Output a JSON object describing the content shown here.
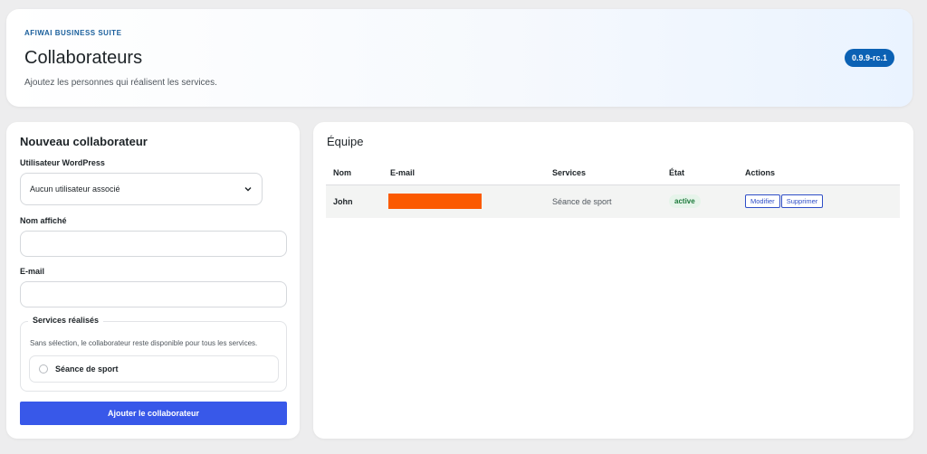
{
  "header": {
    "brand": "AFIWAI BUSINESS SUITE",
    "title": "Collaborateurs",
    "subtitle": "Ajoutez les personnes qui réalisent les services.",
    "version": "0.9.9-rc.1"
  },
  "form": {
    "title": "Nouveau collaborateur",
    "wp_user_label": "Utilisateur WordPress",
    "wp_user_value": "Aucun utilisateur associé",
    "display_name_label": "Nom affiché",
    "display_name_value": "",
    "email_label": "E-mail",
    "email_value": "",
    "services_legend": "Services réalisés",
    "services_hint": "Sans sélection, le collaborateur reste disponible pour tous les services.",
    "services": [
      {
        "label": "Séance de sport",
        "checked": false
      }
    ],
    "submit_label": "Ajouter le collaborateur"
  },
  "team": {
    "title": "Équipe",
    "columns": [
      "Nom",
      "E-mail",
      "Services",
      "État",
      "Actions"
    ],
    "rows": [
      {
        "name": "John",
        "email": "",
        "services": "Séance de sport",
        "state": "active",
        "edit_label": "Modifier",
        "delete_label": "Supprimer"
      }
    ]
  },
  "colors": {
    "accent": "#3858e9",
    "badge": "#0b61b4",
    "redaction": "#fb5a00",
    "active": "#1c7a3b"
  }
}
